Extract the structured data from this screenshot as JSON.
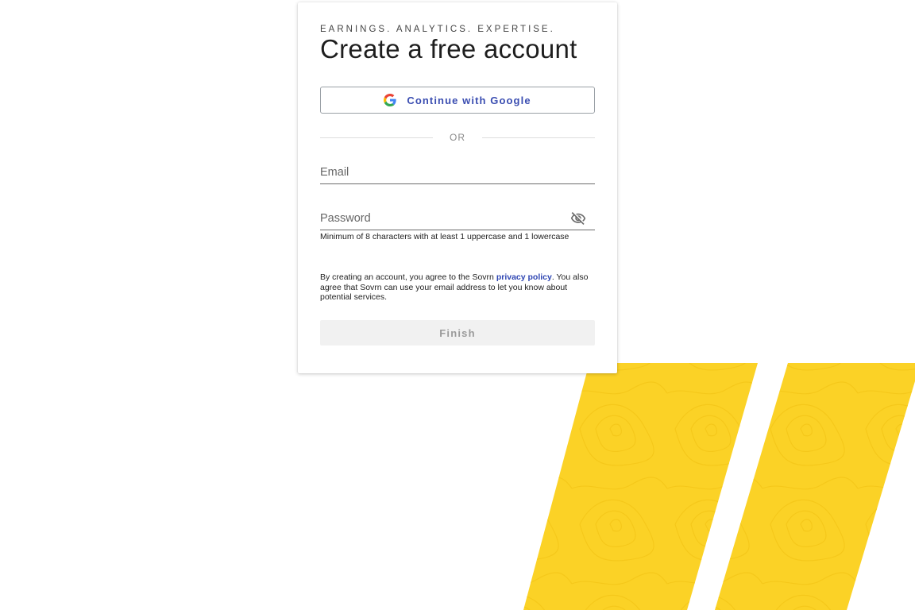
{
  "signup": {
    "tagline": "EARNINGS. ANALYTICS. EXPERTISE.",
    "title": "Create a free account",
    "google_button_label": "Continue with Google",
    "divider_label": "OR",
    "email": {
      "placeholder": "Email",
      "value": ""
    },
    "password": {
      "placeholder": "Password",
      "value": "",
      "hint": "Minimum of 8 characters with at least 1 uppercase and 1 lowercase",
      "toggle_icon": "eye-off-icon"
    },
    "terms": {
      "before_link": "By creating an account, you agree to the Sovrn ",
      "link_label": "privacy policy",
      "after_link": ". You also agree that Sovrn can use your email address to let you know about potential services."
    },
    "finish_button_label": "Finish"
  },
  "colors": {
    "accent": "#3a4db1",
    "link": "#2f46b3",
    "stripe_yellow": "#fbd226",
    "disabled_button_bg": "#f1f1f1",
    "disabled_button_text": "#9a9a9a"
  },
  "icons": {
    "google": "google-g-icon",
    "password_toggle": "eye-off-icon"
  }
}
